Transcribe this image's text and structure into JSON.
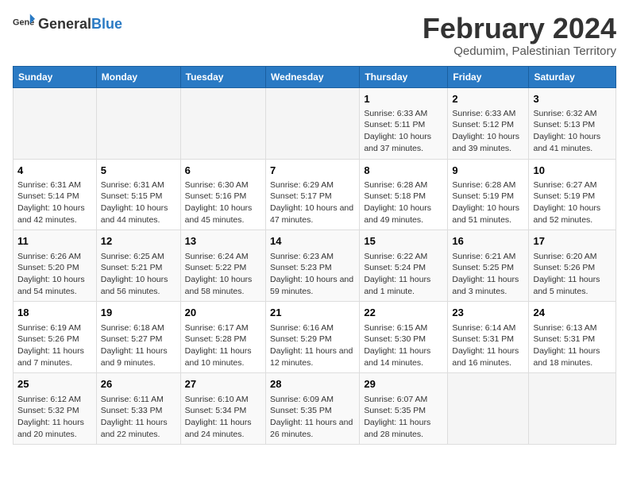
{
  "header": {
    "logo_general": "General",
    "logo_blue": "Blue",
    "title": "February 2024",
    "subtitle": "Qedumim, Palestinian Territory"
  },
  "calendar": {
    "days_of_week": [
      "Sunday",
      "Monday",
      "Tuesday",
      "Wednesday",
      "Thursday",
      "Friday",
      "Saturday"
    ],
    "weeks": [
      [
        {
          "day": "",
          "info": ""
        },
        {
          "day": "",
          "info": ""
        },
        {
          "day": "",
          "info": ""
        },
        {
          "day": "",
          "info": ""
        },
        {
          "day": "1",
          "info": "Sunrise: 6:33 AM\nSunset: 5:11 PM\nDaylight: 10 hours and 37 minutes."
        },
        {
          "day": "2",
          "info": "Sunrise: 6:33 AM\nSunset: 5:12 PM\nDaylight: 10 hours and 39 minutes."
        },
        {
          "day": "3",
          "info": "Sunrise: 6:32 AM\nSunset: 5:13 PM\nDaylight: 10 hours and 41 minutes."
        }
      ],
      [
        {
          "day": "4",
          "info": "Sunrise: 6:31 AM\nSunset: 5:14 PM\nDaylight: 10 hours and 42 minutes."
        },
        {
          "day": "5",
          "info": "Sunrise: 6:31 AM\nSunset: 5:15 PM\nDaylight: 10 hours and 44 minutes."
        },
        {
          "day": "6",
          "info": "Sunrise: 6:30 AM\nSunset: 5:16 PM\nDaylight: 10 hours and 45 minutes."
        },
        {
          "day": "7",
          "info": "Sunrise: 6:29 AM\nSunset: 5:17 PM\nDaylight: 10 hours and 47 minutes."
        },
        {
          "day": "8",
          "info": "Sunrise: 6:28 AM\nSunset: 5:18 PM\nDaylight: 10 hours and 49 minutes."
        },
        {
          "day": "9",
          "info": "Sunrise: 6:28 AM\nSunset: 5:19 PM\nDaylight: 10 hours and 51 minutes."
        },
        {
          "day": "10",
          "info": "Sunrise: 6:27 AM\nSunset: 5:19 PM\nDaylight: 10 hours and 52 minutes."
        }
      ],
      [
        {
          "day": "11",
          "info": "Sunrise: 6:26 AM\nSunset: 5:20 PM\nDaylight: 10 hours and 54 minutes."
        },
        {
          "day": "12",
          "info": "Sunrise: 6:25 AM\nSunset: 5:21 PM\nDaylight: 10 hours and 56 minutes."
        },
        {
          "day": "13",
          "info": "Sunrise: 6:24 AM\nSunset: 5:22 PM\nDaylight: 10 hours and 58 minutes."
        },
        {
          "day": "14",
          "info": "Sunrise: 6:23 AM\nSunset: 5:23 PM\nDaylight: 10 hours and 59 minutes."
        },
        {
          "day": "15",
          "info": "Sunrise: 6:22 AM\nSunset: 5:24 PM\nDaylight: 11 hours and 1 minute."
        },
        {
          "day": "16",
          "info": "Sunrise: 6:21 AM\nSunset: 5:25 PM\nDaylight: 11 hours and 3 minutes."
        },
        {
          "day": "17",
          "info": "Sunrise: 6:20 AM\nSunset: 5:26 PM\nDaylight: 11 hours and 5 minutes."
        }
      ],
      [
        {
          "day": "18",
          "info": "Sunrise: 6:19 AM\nSunset: 5:26 PM\nDaylight: 11 hours and 7 minutes."
        },
        {
          "day": "19",
          "info": "Sunrise: 6:18 AM\nSunset: 5:27 PM\nDaylight: 11 hours and 9 minutes."
        },
        {
          "day": "20",
          "info": "Sunrise: 6:17 AM\nSunset: 5:28 PM\nDaylight: 11 hours and 10 minutes."
        },
        {
          "day": "21",
          "info": "Sunrise: 6:16 AM\nSunset: 5:29 PM\nDaylight: 11 hours and 12 minutes."
        },
        {
          "day": "22",
          "info": "Sunrise: 6:15 AM\nSunset: 5:30 PM\nDaylight: 11 hours and 14 minutes."
        },
        {
          "day": "23",
          "info": "Sunrise: 6:14 AM\nSunset: 5:31 PM\nDaylight: 11 hours and 16 minutes."
        },
        {
          "day": "24",
          "info": "Sunrise: 6:13 AM\nSunset: 5:31 PM\nDaylight: 11 hours and 18 minutes."
        }
      ],
      [
        {
          "day": "25",
          "info": "Sunrise: 6:12 AM\nSunset: 5:32 PM\nDaylight: 11 hours and 20 minutes."
        },
        {
          "day": "26",
          "info": "Sunrise: 6:11 AM\nSunset: 5:33 PM\nDaylight: 11 hours and 22 minutes."
        },
        {
          "day": "27",
          "info": "Sunrise: 6:10 AM\nSunset: 5:34 PM\nDaylight: 11 hours and 24 minutes."
        },
        {
          "day": "28",
          "info": "Sunrise: 6:09 AM\nSunset: 5:35 PM\nDaylight: 11 hours and 26 minutes."
        },
        {
          "day": "29",
          "info": "Sunrise: 6:07 AM\nSunset: 5:35 PM\nDaylight: 11 hours and 28 minutes."
        },
        {
          "day": "",
          "info": ""
        },
        {
          "day": "",
          "info": ""
        }
      ]
    ]
  }
}
